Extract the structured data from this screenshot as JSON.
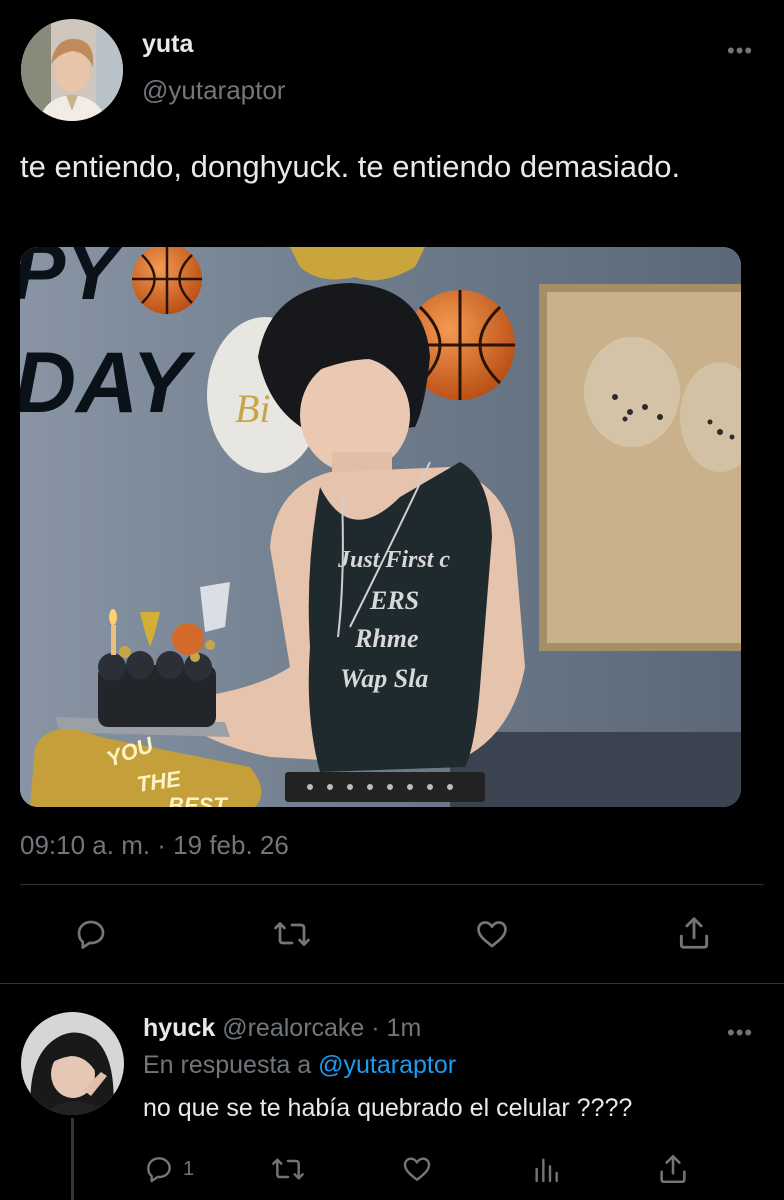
{
  "tweet": {
    "author_name": "yuta",
    "author_handle": "@yutaraptor",
    "text": "te entiendo, donghyuck. te entiendo demasiado.",
    "timestamp": "09:10 a. m. · 19 feb. 26",
    "media_text": {
      "banner_top": "PY",
      "banner_bottom": "DAY",
      "balloon_text": "Bi",
      "shirt_lines": [
        "Just First c",
        "ERS",
        "Rhme",
        "Wap Sla"
      ],
      "cake_sign_1": "YOU",
      "cake_sign_2": "THE",
      "cake_sign_3": "BEST"
    }
  },
  "reply": {
    "author_name": "hyuck",
    "author_handle": "@realorcake · 1m",
    "reply_to_prefix": "En respuesta a",
    "reply_to_handle": "@yutaraptor",
    "text": "no que se te había quebrado el celular ????",
    "reply_count": "1"
  },
  "icons": {
    "more": "more-icon",
    "reply": "reply-icon",
    "retweet": "retweet-icon",
    "like": "heart-icon",
    "share": "share-icon",
    "views": "views-icon"
  },
  "colors": {
    "background": "#000000",
    "text": "#e7e9ea",
    "muted": "#71767b",
    "link": "#1d9bf0",
    "divider": "#2f3336"
  }
}
